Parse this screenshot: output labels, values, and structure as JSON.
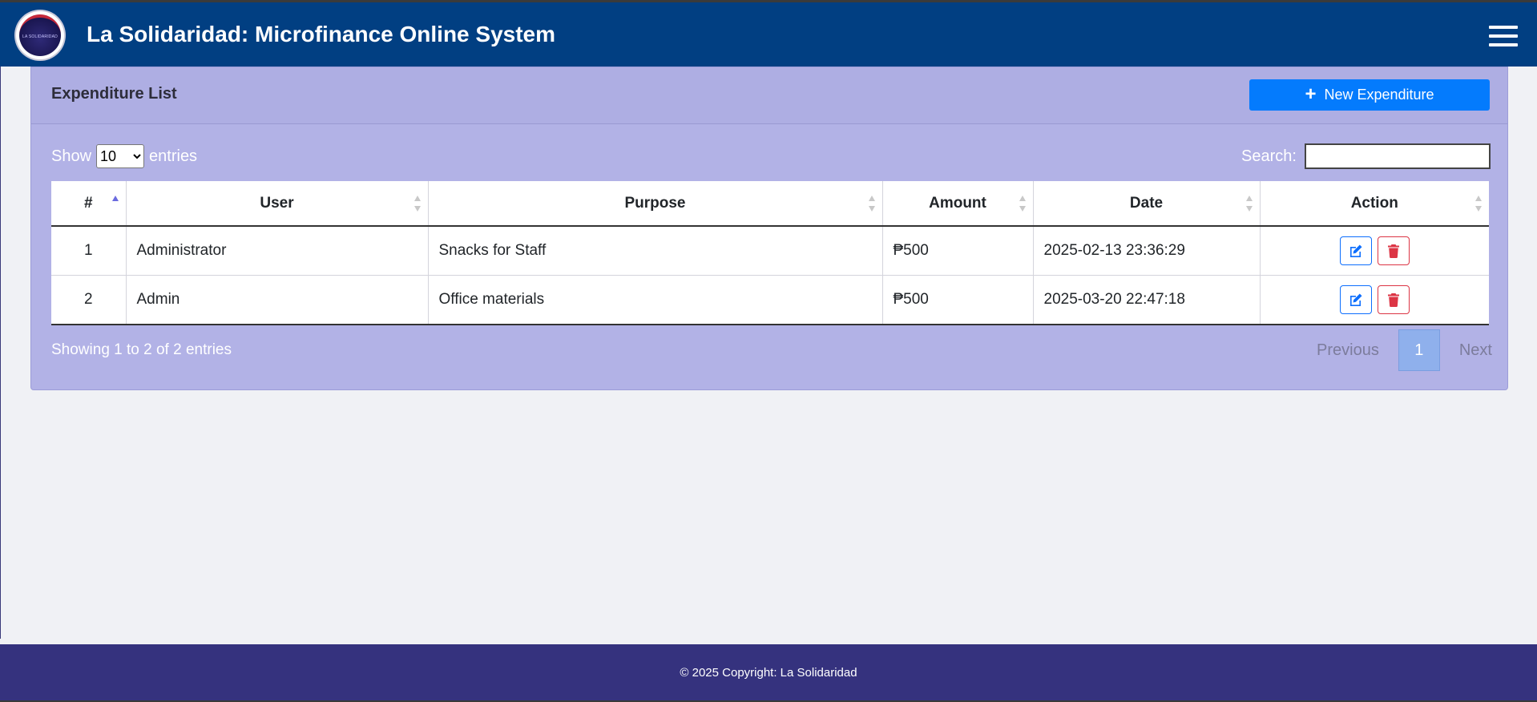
{
  "navbar": {
    "brand": "La Solidaridad: Microfinance Online System",
    "logo_text": "LA SOLIDARIDAD",
    "menu_icon": "hamburger-icon"
  },
  "card": {
    "title": "Expenditure List",
    "new_button_label": "New Expenditure",
    "new_button_icon": "plus-icon"
  },
  "table_controls": {
    "show_label": "Show",
    "entries_label": "entries",
    "page_length": "10",
    "search_label": "Search:",
    "search_value": ""
  },
  "table": {
    "headers": [
      "#",
      "User",
      "Purpose",
      "Amount",
      "Date",
      "Action"
    ],
    "rows": [
      {
        "num": "1",
        "user": "Administrator",
        "purpose": "Snacks for Staff",
        "amount": "₱500",
        "date": "2025-02-13 23:36:29"
      },
      {
        "num": "2",
        "user": "Admin",
        "purpose": "Office materials",
        "amount": "₱500",
        "date": "2025-03-20 22:47:18"
      }
    ],
    "sorted_column": "#",
    "sort_direction": "ascending"
  },
  "pagination": {
    "info": "Showing 1 to 2 of 2 entries",
    "previous": "Previous",
    "current": "1",
    "next": "Next"
  },
  "footer": {
    "text": "© 2025 Copyright: La Solidaridad"
  },
  "colors": {
    "navbar": "#013f82",
    "card": "#b2b2e6",
    "primary_button": "#047bfd",
    "footer": "#35327e",
    "edit": "#0d6efd",
    "delete": "#dc3545"
  }
}
